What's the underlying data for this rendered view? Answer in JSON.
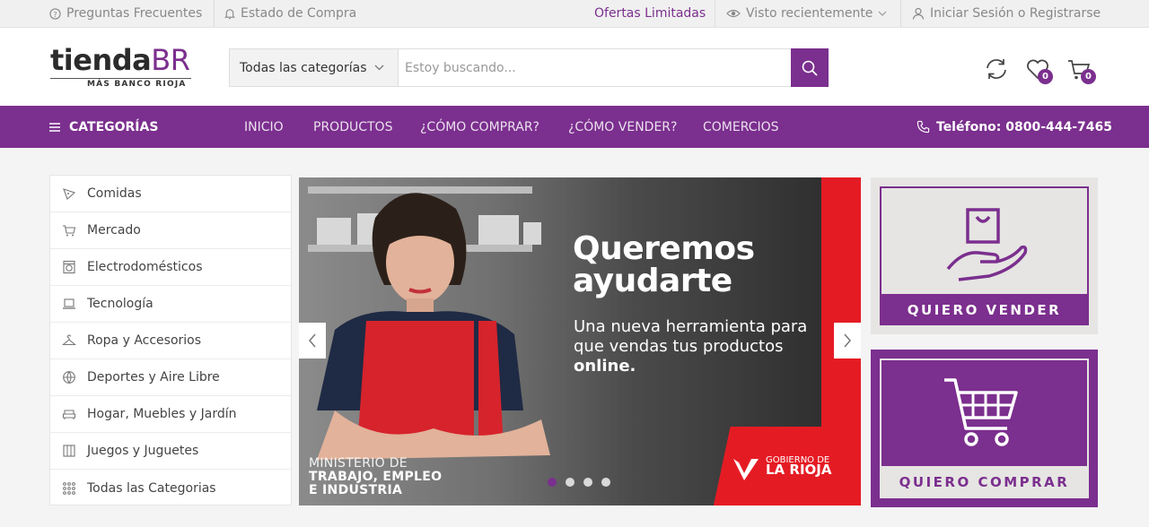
{
  "topbar": {
    "faq": "Preguntas Frecuentes",
    "order_status": "Estado de Compra",
    "offers": "Ofertas Limitadas",
    "recent": "Visto recientemente",
    "login": "Iniciar Sesión o Registrarse"
  },
  "logo": {
    "name_dark": "tienda",
    "name_accent": "BR",
    "tagline": "MÁS BANCO RIOJA"
  },
  "search": {
    "category": "Todas las categorías",
    "placeholder": "Estoy buscando..."
  },
  "header_icons": {
    "wishlist_count": "0",
    "cart_count": "0"
  },
  "nav": {
    "categories": "CATEGORÍAS",
    "items": [
      "INICIO",
      "PRODUCTOS",
      "¿CÓMO COMPRAR?",
      "¿CÓMO VENDER?",
      "COMERCIOS"
    ],
    "phone": "Teléfono: 0800-444-7465"
  },
  "sidebar": {
    "items": [
      {
        "label": "Comidas",
        "icon": "food-icon"
      },
      {
        "label": "Mercado",
        "icon": "cart-icon"
      },
      {
        "label": "Electrodomésticos",
        "icon": "washer-icon"
      },
      {
        "label": "Tecnología",
        "icon": "laptop-icon"
      },
      {
        "label": "Ropa y Accesorios",
        "icon": "hanger-icon"
      },
      {
        "label": "Deportes y Aire Libre",
        "icon": "ball-icon"
      },
      {
        "label": "Hogar, Muebles y Jardín",
        "icon": "sofa-icon"
      },
      {
        "label": "Juegos y Juguetes",
        "icon": "game-icon"
      },
      {
        "label": "Todas las Categorias",
        "icon": "grid-icon"
      }
    ]
  },
  "banner": {
    "title_line1": "Queremos",
    "title_line2": "ayudarte",
    "sub_line1": "Una nueva herramienta para",
    "sub_line2": "que vendas tus productos",
    "sub_line3": "online.",
    "ministry_line1": "MINISTERIO DE",
    "ministry_line2": "TRABAJO, EMPLEO",
    "ministry_line3": "E INDUSTRIA",
    "gov_line1": "GOBIERNO DE",
    "gov_line2": "LA RIOJA",
    "slides_total": 4,
    "active_slide": 1
  },
  "promos": {
    "sell": "QUIERO VENDER",
    "buy": "QUIERO COMPRAR"
  },
  "colors": {
    "brand": "#7b2f8e",
    "accent_red": "#e51b24"
  }
}
